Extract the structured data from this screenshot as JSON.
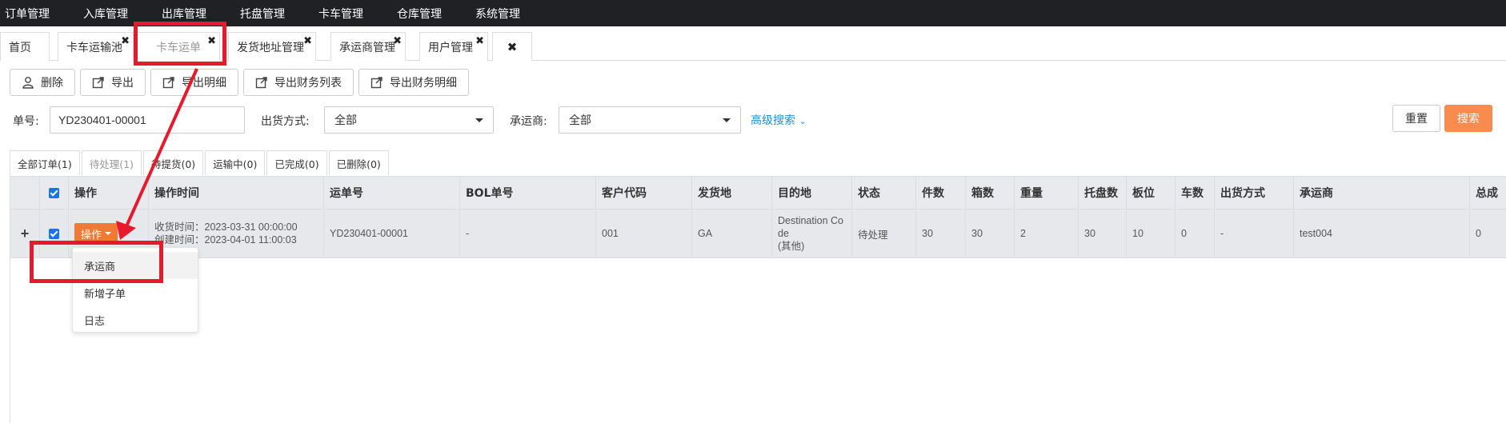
{
  "topnav": {
    "items": [
      "订单管理",
      "入库管理",
      "出库管理",
      "托盘管理",
      "卡车管理",
      "仓库管理",
      "系统管理"
    ]
  },
  "tabs": [
    {
      "label": "首页",
      "closable": false
    },
    {
      "label": "卡车运输池",
      "closable": true
    },
    {
      "label": "卡车运单",
      "closable": true,
      "active": true
    },
    {
      "label": "发货地址管理",
      "closable": true
    },
    {
      "label": "承运商管理",
      "closable": true
    },
    {
      "label": "用户管理",
      "closable": true
    },
    {
      "label": "",
      "closable": true
    }
  ],
  "toolbar": {
    "delete_label": "删除",
    "export_label": "导出",
    "export_detail_label": "导出明细",
    "export_finance_list_label": "导出财务列表",
    "export_finance_detail_label": "导出财务明细"
  },
  "search": {
    "order_no_label": "单号:",
    "order_no_value": "YD230401-00001",
    "ship_method_label": "出货方式:",
    "ship_method_value": "全部",
    "carrier_label": "承运商:",
    "carrier_value": "全部",
    "advanced_label": "高级搜索",
    "reset_label": "重置",
    "search_label": "搜索"
  },
  "status_tabs": [
    {
      "label": "全部订单(1)"
    },
    {
      "label": "待处理(1)",
      "active": true
    },
    {
      "label": "待提货(0)"
    },
    {
      "label": "运输中(0)"
    },
    {
      "label": "已完成(0)"
    },
    {
      "label": "已删除(0)"
    }
  ],
  "table": {
    "headers": [
      "操作",
      "操作时间",
      "运单号",
      "BOL单号",
      "客户代码",
      "发货地",
      "目的地",
      "状态",
      "件数",
      "箱数",
      "重量",
      "托盘数",
      "板位",
      "车数",
      "出货方式",
      "承运商",
      "总成"
    ],
    "row": {
      "op_label": "操作",
      "time_line1": "收货时间：2023-03-31 00:00:00",
      "time_line2": "创建时间：2023-04-01 11:00:03",
      "waybill_no": "YD230401-00001",
      "bol_no": "-",
      "customer_code": "001",
      "origin": "GA",
      "destination_line1": "Destination Co",
      "destination_line2": "de",
      "destination_line3": "(其他)",
      "status": "待处理",
      "pieces": "30",
      "boxes": "30",
      "weight": "2",
      "pallets": "30",
      "board_slots": "10",
      "trucks": "0",
      "ship_method": "-",
      "carrier": "test004",
      "total": "0"
    }
  },
  "row_menu": {
    "items": [
      "承运商",
      "新增子单",
      "日志"
    ]
  },
  "colors": {
    "topnav_bg": "#1f2124",
    "accent_orange": "#f98b4f",
    "op_button": "#f07a35",
    "link_blue": "#1e90d6",
    "annotation_red": "#e8192c"
  }
}
